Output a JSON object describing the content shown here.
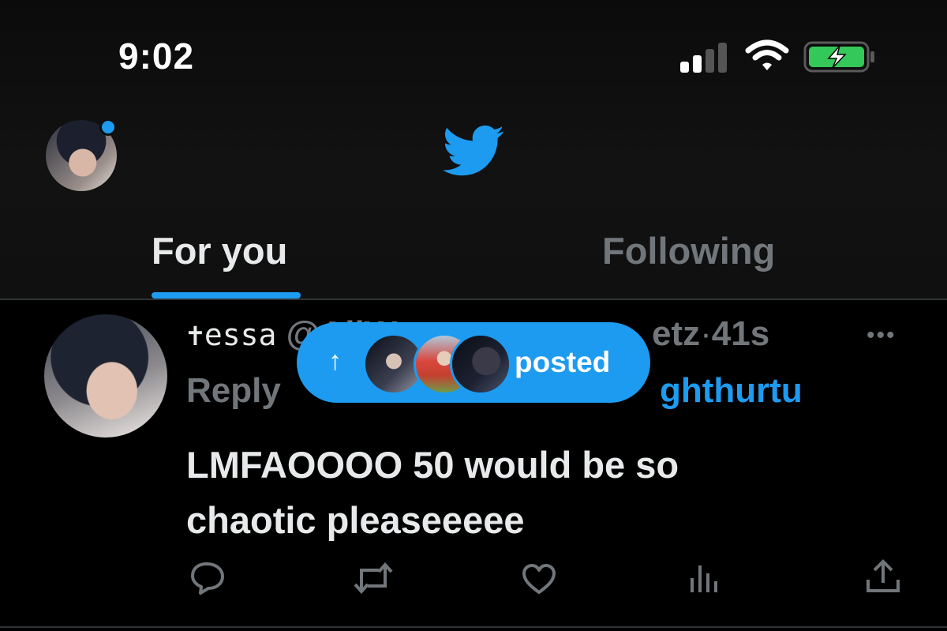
{
  "status_bar": {
    "time": "9:02",
    "signal_bars_active": 2,
    "signal_bars_total": 4,
    "battery_state": "charging",
    "icons": [
      "signal-icon",
      "wifi-icon",
      "battery-charging-icon"
    ]
  },
  "nav": {
    "logo_icon": "twitter-bird-icon",
    "tabs": [
      {
        "label": "For you",
        "selected": true
      },
      {
        "label": "Following",
        "selected": false
      }
    ]
  },
  "tweet": {
    "name": "✝︎essa",
    "handle_visible": "@AllW",
    "handle_tail": "etz",
    "separator": "·",
    "age": "41s",
    "replying_prefix": "Reply",
    "replying_mention": "ghthurtu",
    "text_line1": "LMFAOOOO 50 would be so",
    "text_line2": "chaotic pleaseeeee",
    "actions": [
      "reply-icon",
      "retweet-icon",
      "like-icon",
      "views-icon",
      "share-icon"
    ]
  },
  "toast": {
    "arrow": "↑",
    "label": "posted",
    "avatar_count": 3
  },
  "colors": {
    "accent": "#1d9bf0",
    "text_primary": "#e7e9ea",
    "text_secondary": "#71767b",
    "battery_green": "#34c759"
  }
}
